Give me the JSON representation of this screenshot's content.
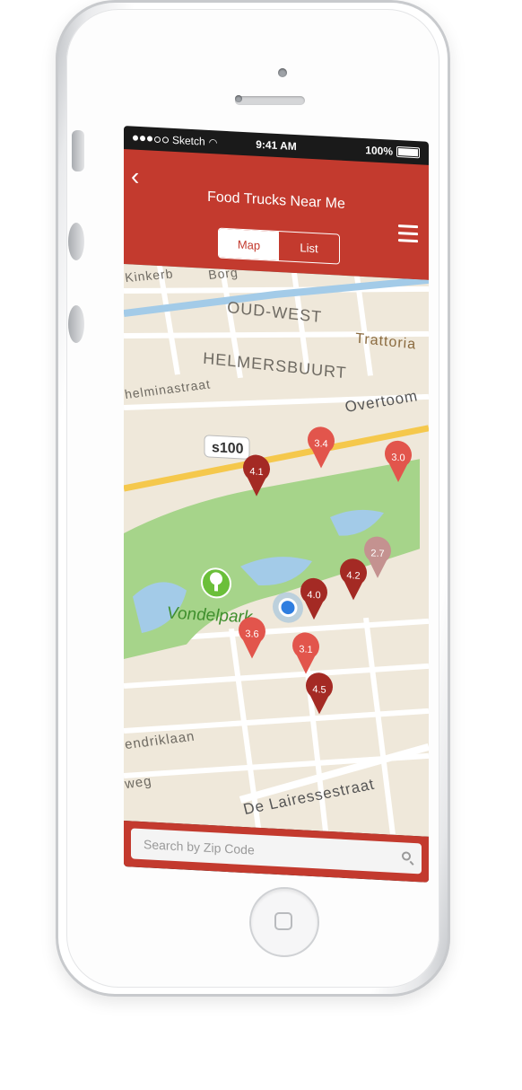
{
  "status": {
    "carrier": "Sketch",
    "time": "9:41 AM",
    "battery": "100%"
  },
  "nav": {
    "back_icon": "chevron-left-icon",
    "title": "Food Trucks Near Me",
    "menu_icon": "hamburger-menu-icon",
    "tabs": [
      {
        "label": "Map",
        "selected": true
      },
      {
        "label": "List",
        "selected": false
      }
    ]
  },
  "map": {
    "places": [
      {
        "name": "Kinkerb",
        "kind": "district"
      },
      {
        "name": "Borg",
        "kind": "district"
      },
      {
        "name": "OUD-WEST",
        "kind": "district"
      },
      {
        "name": "HELMERSBUURT",
        "kind": "district"
      },
      {
        "name": "Trattoria",
        "kind": "poi"
      },
      {
        "name": "Overtoom",
        "kind": "street"
      },
      {
        "name": "helminastraat",
        "kind": "street"
      },
      {
        "name": "s100",
        "kind": "route"
      },
      {
        "name": "Vondelpark",
        "kind": "park"
      },
      {
        "name": "endriklaan",
        "kind": "street"
      },
      {
        "name": "weg",
        "kind": "street"
      },
      {
        "name": "De Lairessestraat",
        "kind": "street"
      }
    ],
    "pins": [
      {
        "rating": "3.4",
        "color": "#e2554c"
      },
      {
        "rating": "3.0",
        "color": "#e2554c"
      },
      {
        "rating": "4.1",
        "color": "#a42a24"
      },
      {
        "rating": "2.7",
        "color": "#c49290"
      },
      {
        "rating": "4.2",
        "color": "#a42a24"
      },
      {
        "rating": "4.0",
        "color": "#a42a24"
      },
      {
        "rating": "3.6",
        "color": "#e2554c"
      },
      {
        "rating": "3.1",
        "color": "#e2554c"
      },
      {
        "rating": "4.5",
        "color": "#a42a24"
      }
    ],
    "park_icon": "tree-icon",
    "user_location_icon": "current-location-icon"
  },
  "search": {
    "placeholder": "Search by Zip Code",
    "icon": "search-icon"
  },
  "colors": {
    "accent": "#c33a2e",
    "park": "#a6d48a",
    "water": "#a3cbe8",
    "road_major": "#f5c84c"
  }
}
